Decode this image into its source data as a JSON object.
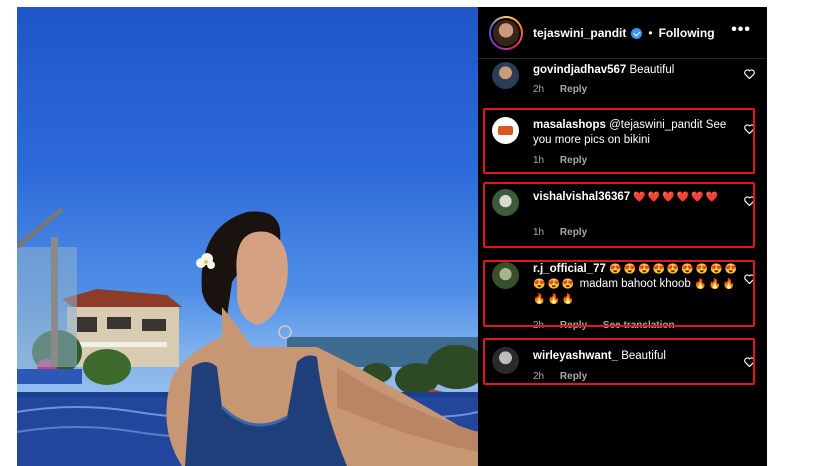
{
  "post": {
    "username": "tejaswini_pandit",
    "separator": "•",
    "follow_status": "Following",
    "more_label": "•••"
  },
  "comments": [
    {
      "username": "govindjadhav567",
      "text": "Beautiful",
      "time": "2h",
      "reply": "Reply",
      "translate": ""
    },
    {
      "username": "masalashops",
      "text": "@tejaswini_pandit See you more pics on bikini",
      "time": "1h",
      "reply": "Reply",
      "translate": ""
    },
    {
      "username": "vishalvishal36367",
      "text": "",
      "time": "1h",
      "reply": "Reply",
      "translate": "",
      "emoji": [
        "❤️",
        "❤️",
        "❤️",
        "❤️",
        "❤️",
        "❤️"
      ]
    },
    {
      "username": "r.j_official_77",
      "text": "madam bahoot khoob",
      "time": "2h",
      "reply": "Reply",
      "translate": "See translation",
      "emoji_a": [
        "😍",
        "😍",
        "😍",
        "😍",
        "😍",
        "😍",
        "😍",
        "😍",
        "😍",
        "😍",
        "😍",
        "😍"
      ],
      "emoji_b": [
        "🔥",
        "🔥",
        "🔥",
        "🔥",
        "🔥",
        "🔥"
      ]
    },
    {
      "username": "wirleyashwant_",
      "text": "Beautiful",
      "time": "2h",
      "reply": "Reply",
      "translate": ""
    }
  ],
  "icons": {
    "verified": "verified-badge-icon",
    "like": "heart-outline-icon",
    "more": "more-options-icon"
  },
  "colors": {
    "highlight": "#e3141a",
    "verified": "#3897f0",
    "background": "#000000"
  }
}
